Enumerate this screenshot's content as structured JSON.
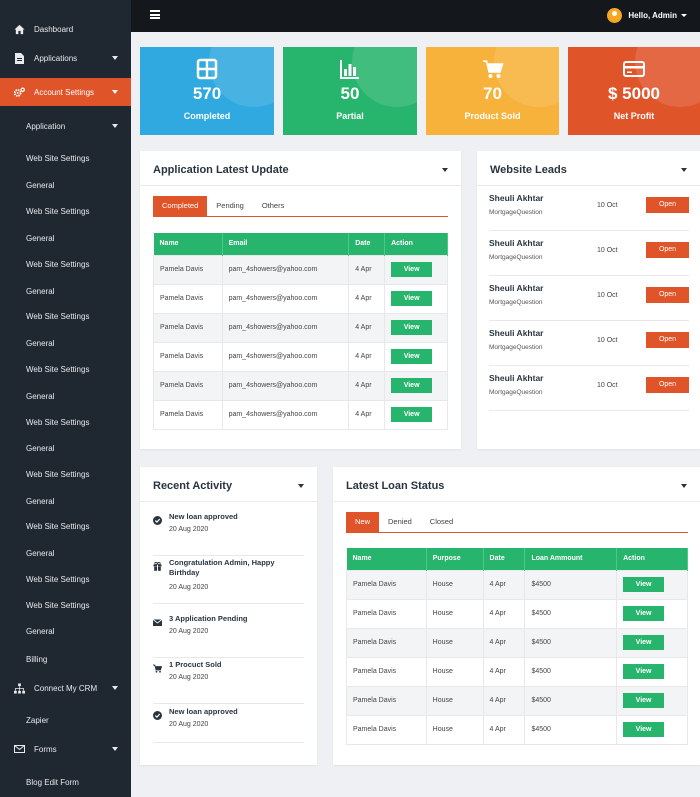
{
  "sidebar": {
    "dashboard": "Dashboard",
    "applications": "Applications",
    "account_settings": "Account Settings",
    "application": "Application",
    "website_settings": "Web Site Settings",
    "general": "General",
    "billing": "Billing",
    "connect_crm": "Connect My CRM",
    "zapier": "Zapier",
    "forms": "Forms",
    "blog_edit_form": "Blog Edit Form"
  },
  "header": {
    "user_greeting": "Hello, Admin"
  },
  "stats": [
    {
      "value": "570",
      "label": "Completed",
      "color": "#2fa9e0"
    },
    {
      "value": "50",
      "label": "Partial",
      "color": "#27b46d"
    },
    {
      "value": "70",
      "label": "Product Sold",
      "color": "#f7b23b"
    },
    {
      "value": "$ 5000",
      "label": "Net Profit",
      "color": "#e0542a"
    }
  ],
  "app_update": {
    "title": "Application Latest Update",
    "tabs": [
      "Completed",
      "Pending",
      "Others"
    ],
    "columns": [
      "Name",
      "Email",
      "Date",
      "Action"
    ],
    "rows": [
      [
        "Pamela Davis",
        "pam_4showers@yahoo.com",
        "4 Apr",
        "View"
      ],
      [
        "Pamela Davis",
        "pam_4showers@yahoo.com",
        "4 Apr",
        "View"
      ],
      [
        "Pamela Davis",
        "pam_4showers@yahoo.com",
        "4 Apr",
        "View"
      ],
      [
        "Pamela Davis",
        "pam_4showers@yahoo.com",
        "4 Apr",
        "View"
      ],
      [
        "Pamela Davis",
        "pam_4showers@yahoo.com",
        "4 Apr",
        "View"
      ],
      [
        "Pamela Davis",
        "pam_4showers@yahoo.com",
        "4 Apr",
        "View"
      ]
    ]
  },
  "leads": {
    "title": "Website Leads",
    "items": [
      {
        "name": "Sheuli Akhtar",
        "sub": "MortgageQuestion",
        "date": "10 Oct",
        "action": "Open"
      },
      {
        "name": "Sheuli Akhtar",
        "sub": "MortgageQuestion",
        "date": "10 Oct",
        "action": "Open"
      },
      {
        "name": "Sheuli Akhtar",
        "sub": "MortgageQuestion",
        "date": "10 Oct",
        "action": "Open"
      },
      {
        "name": "Sheuli Akhtar",
        "sub": "MortgageQuestion",
        "date": "10 Oct",
        "action": "Open"
      },
      {
        "name": "Sheuli Akhtar",
        "sub": "MortgageQuestion",
        "date": "10 Oct",
        "action": "Open"
      }
    ]
  },
  "activity": {
    "title": "Recent Activity",
    "items": [
      {
        "icon": "check-circle-icon",
        "text": "New loan approved",
        "date": "20 Aug 2020"
      },
      {
        "icon": "gift-icon",
        "text": "Congratulation Admin, Happy Birthday",
        "date": "20 Aug 2020"
      },
      {
        "icon": "envelope-icon",
        "text": "3 Application Pending",
        "date": "20 Aug 2020"
      },
      {
        "icon": "cart-icon",
        "text": "1 Procuct Sold",
        "date": "20 Aug 2020"
      },
      {
        "icon": "check-circle-icon",
        "text": "New loan approved",
        "date": "20 Aug 2020"
      }
    ]
  },
  "loan": {
    "title": "Latest Loan Status",
    "tabs": [
      "New",
      "Denied",
      "Closed"
    ],
    "columns": [
      "Name",
      "Purpose",
      "Date",
      "Loan Ammount",
      "Action"
    ],
    "rows": [
      [
        "Pamela Davis",
        "House",
        "4 Apr",
        "$4500",
        "View"
      ],
      [
        "Pamela Davis",
        "House",
        "4 Apr",
        "$4500",
        "View"
      ],
      [
        "Pamela Davis",
        "House",
        "4 Apr",
        "$4500",
        "View"
      ],
      [
        "Pamela Davis",
        "House",
        "4 Apr",
        "$4500",
        "View"
      ],
      [
        "Pamela Davis",
        "House",
        "4 Apr",
        "$4500",
        "View"
      ],
      [
        "Pamela Davis",
        "House",
        "4 Apr",
        "$4500",
        "View"
      ]
    ]
  }
}
